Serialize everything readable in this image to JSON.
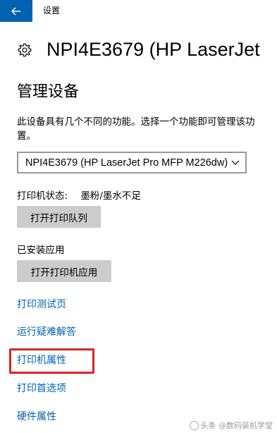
{
  "window": {
    "title": "设置",
    "back_icon": "back-arrow-icon",
    "accent_color": "#0063b1"
  },
  "header": {
    "icon": "gear-icon",
    "title": "NPI4E3679 (HP LaserJet"
  },
  "manage": {
    "section_title": "管理设备",
    "description_line1": "此设备具有几个不同的功能。选择一个功能即可管理该功",
    "description_line2": "置。",
    "device_select_value": "NPI4E3679 (HP LaserJet Pro MFP M226dw)",
    "printer_status_label": "打印机状态:",
    "printer_status_value": "墨粉/墨水不足",
    "open_queue_button": "打开打印队列",
    "installed_apps_label": "已安装应用",
    "open_app_button": "打开打印机应用"
  },
  "links": {
    "test_page": "打印测试页",
    "troubleshoot": "运行疑难解答",
    "printer_properties": "打印机属性",
    "printing_preferences": "打印首选项",
    "hardware_properties": "硬件属性"
  },
  "annotation": {
    "highlight_color": "#d9242b"
  },
  "watermark": {
    "text": "头条 @数码装机学堂"
  }
}
